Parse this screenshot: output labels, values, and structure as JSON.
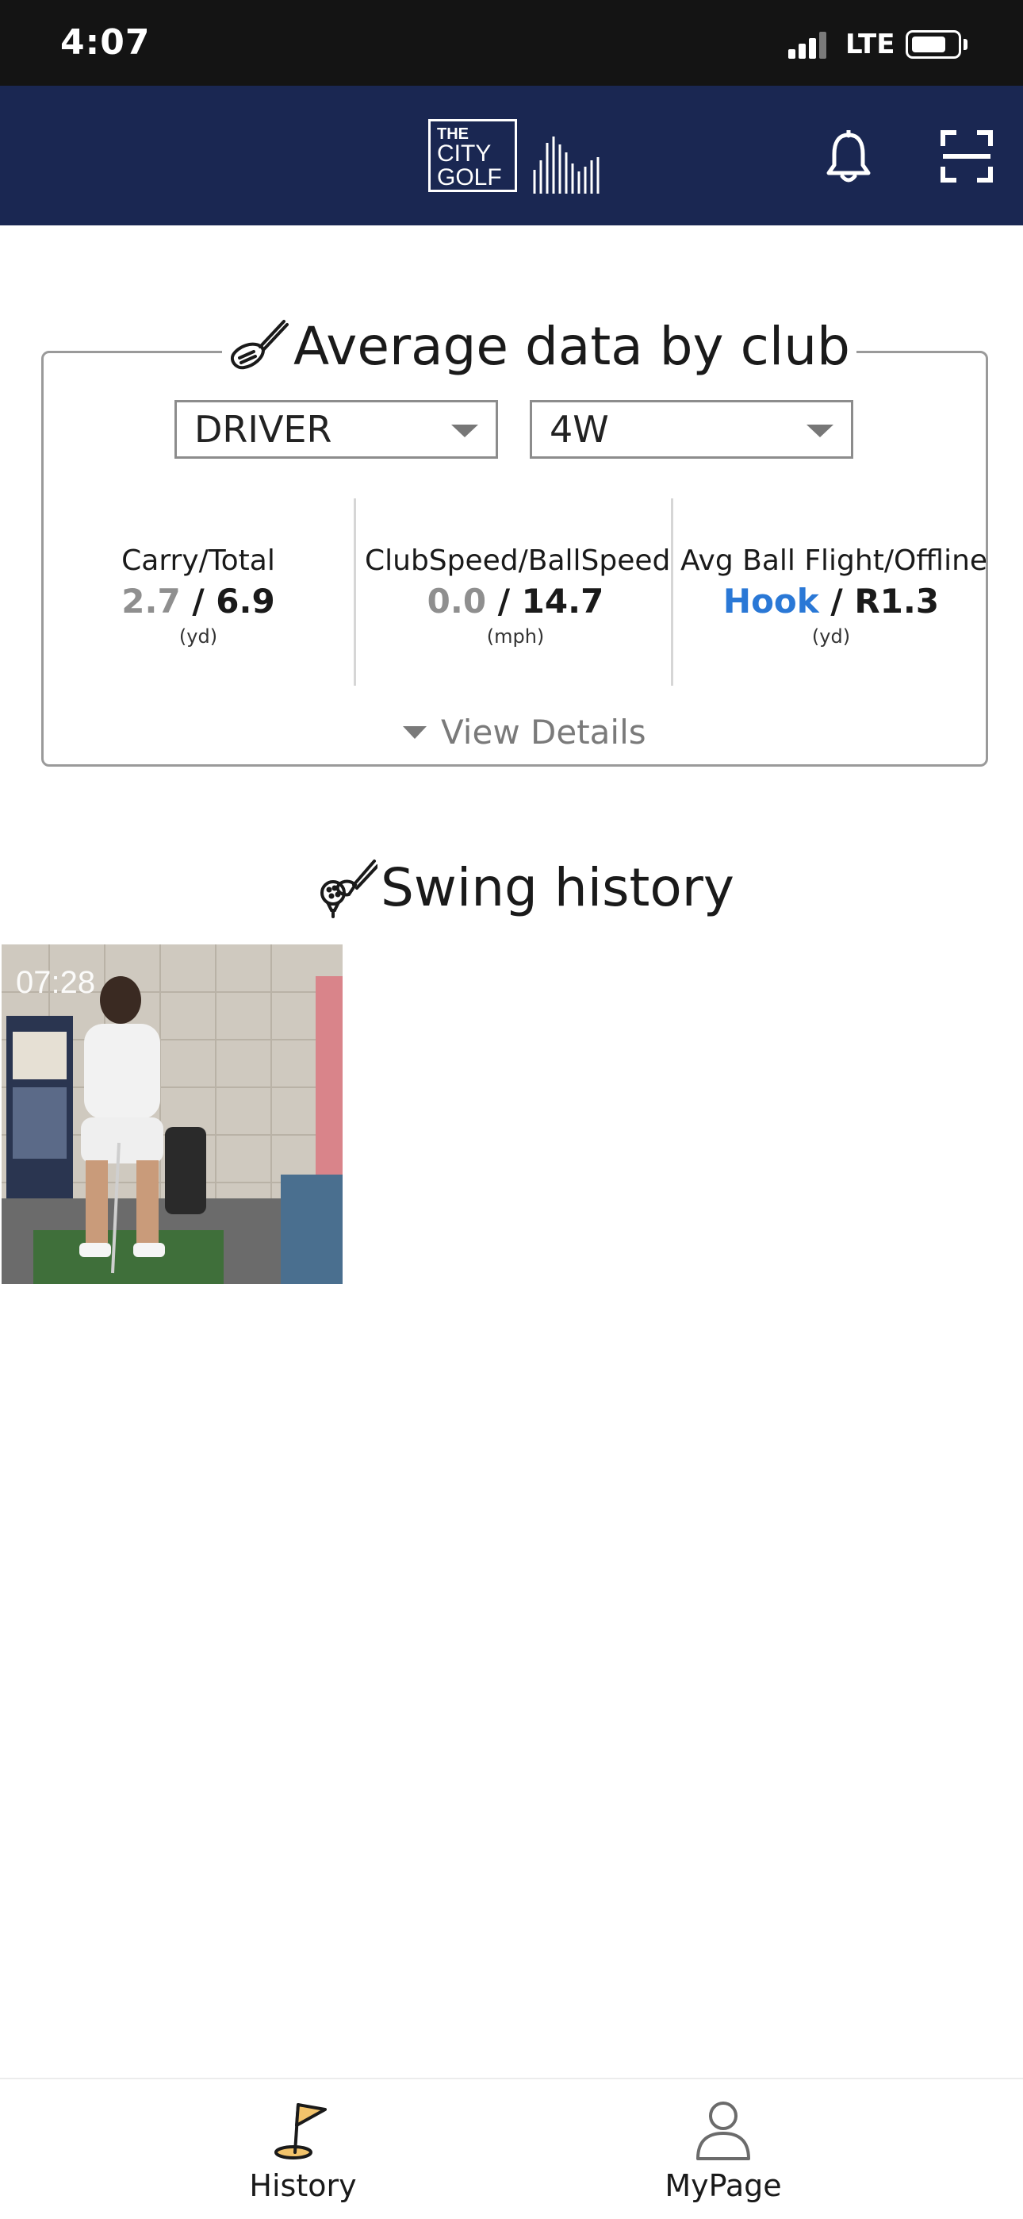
{
  "status_bar": {
    "time": "4:07",
    "network": "LTE",
    "battery_level": 0.7
  },
  "header": {
    "logo_text": [
      "THE",
      "CITY",
      "GOLF"
    ],
    "colors": {
      "background": "#1a2752"
    }
  },
  "average_data": {
    "title": "Average data by club",
    "club_select_1": "DRIVER",
    "club_select_2": "4W",
    "stats": [
      {
        "label": "Carry/Total",
        "value_a": "2.7",
        "value_b": "6.9",
        "unit": "(yd)"
      },
      {
        "label": "ClubSpeed/BallSpeed",
        "value_a": "0.0",
        "value_b": "14.7",
        "unit": "(mph)"
      },
      {
        "label": "Avg Ball Flight/Offline",
        "value_a": "Hook",
        "value_b": "R1.3",
        "unit": "(yd)"
      }
    ],
    "view_details_label": "View Details",
    "colors": {
      "hook": "#2a78d6",
      "muted": "#8f8f8f"
    }
  },
  "swing_history": {
    "title": "Swing history",
    "items": [
      {
        "timestamp": "07:28"
      }
    ]
  },
  "bottom_nav": {
    "items": [
      {
        "label": "History",
        "icon": "golf-flag-icon"
      },
      {
        "label": "MyPage",
        "icon": "person-icon"
      }
    ]
  }
}
